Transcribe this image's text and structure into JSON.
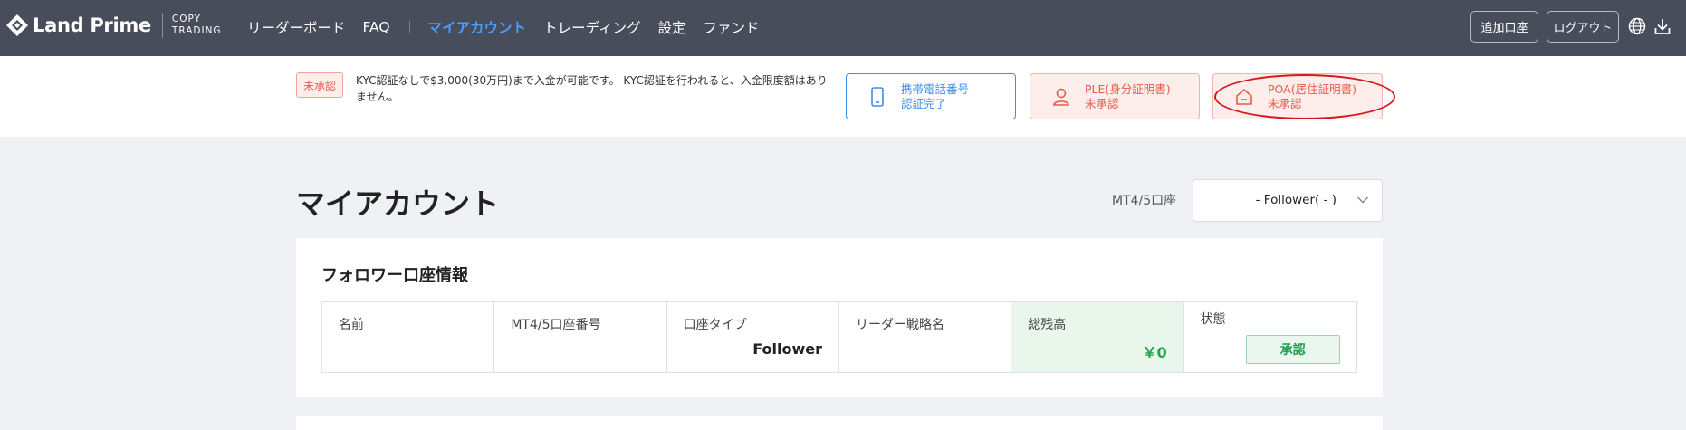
{
  "brand": {
    "name": "Land Prime",
    "sub_line1": "COPY",
    "sub_line2": "TRADING"
  },
  "nav": {
    "items": [
      "リーダーボード",
      "FAQ",
      "マイアカウント",
      "トレーディング",
      "設定",
      "ファンド"
    ]
  },
  "top_actions": {
    "add_account": "追加口座",
    "logout": "ログアウト"
  },
  "icons": {
    "language": "globe-icon",
    "download": "download-icon"
  },
  "kyc": {
    "badge": "未承認",
    "text": "KYC認証なしで$3,000(30万円)まで入金が可能です。 KYC認証を行われると、入金限度額はありません。",
    "cards": [
      {
        "line1": "携帯電話番号",
        "line2": "認証完了",
        "status": "ok"
      },
      {
        "line1": "PLE(身分証明書)",
        "line2": "未承認",
        "status": "pending"
      },
      {
        "line1": "POA(居住証明書)",
        "line2": "未承認",
        "status": "pending"
      }
    ]
  },
  "main": {
    "title": "マイアカウント",
    "account_label": "MT4/5口座",
    "account_value": "- Follower( - )"
  },
  "follower_info": {
    "title": "フォロワー口座情報",
    "columns": [
      {
        "header": "名前",
        "value": ""
      },
      {
        "header": "MT4/5口座番号",
        "value": ""
      },
      {
        "header": "口座タイプ",
        "value": "Follower"
      },
      {
        "header": "リーダー戦略名",
        "value": ""
      },
      {
        "header": "総残高",
        "value": "￥0"
      },
      {
        "header": "状態",
        "value": "承認"
      }
    ]
  },
  "colors": {
    "nav_bg": "#474d5a",
    "accent": "#4a9eff",
    "error": "#e65a4a",
    "success": "#1fa64a"
  }
}
